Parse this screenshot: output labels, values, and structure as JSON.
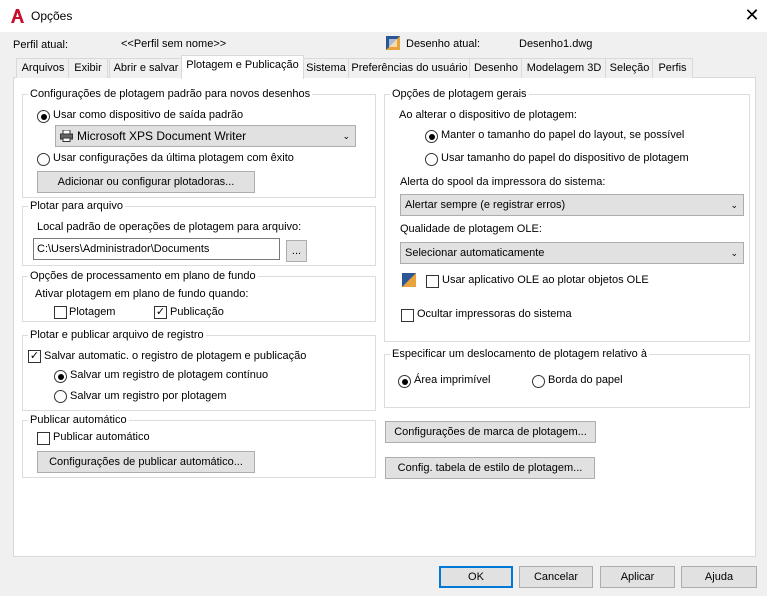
{
  "window": {
    "title": "Opções",
    "close_glyph": "✕"
  },
  "profile": {
    "label": "Perfil atual:",
    "value": "<<Perfil sem nome>>"
  },
  "drawing": {
    "label": "Desenho atual:",
    "value": "Desenho1.dwg"
  },
  "tabs": [
    {
      "label": "Arquivos"
    },
    {
      "label": "Exibir"
    },
    {
      "label": "Abrir e salvar"
    },
    {
      "label": "Plotagem e Publicação"
    },
    {
      "label": "Sistema"
    },
    {
      "label": "Preferências do usuário"
    },
    {
      "label": "Desenho"
    },
    {
      "label": "Modelagem 3D"
    },
    {
      "label": "Seleção"
    },
    {
      "label": "Perfis"
    }
  ],
  "default_plot": {
    "legend": "Configurações de plotagem padrão para novos desenhos",
    "use_default_label": "Usar como dispositivo de saída padrão",
    "device_value": "Microsoft XPS Document Writer",
    "use_last_label": "Usar configurações da última plotagem com êxito",
    "add_plotter_button": "Adicionar ou configurar plotadoras..."
  },
  "plot_to_file": {
    "legend": "Plotar para arquivo",
    "location_label": "Local padrão de operações de plotagem para arquivo:",
    "path_value": "C:\\Users\\Administrador\\Documents",
    "browse_button": "..."
  },
  "background": {
    "legend": "Opções de processamento em plano de fundo",
    "enable_label": "Ativar plotagem em plano de fundo quando:",
    "plotting_label": "Plotagem",
    "publishing_label": "Publicação",
    "publishing_check": "✓"
  },
  "log": {
    "legend": "Plotar e publicar arquivo de registro",
    "auto_save_label": "Salvar automatic. o registro de plotagem e publicação",
    "auto_save_check": "✓",
    "continuous_label": "Salvar um registro de plotagem contínuo",
    "per_plot_label": "Salvar um registro por plotagem"
  },
  "auto_publish": {
    "legend": "Publicar automático",
    "checkbox_label": "Publicar automático",
    "settings_button": "Configurações de publicar automático..."
  },
  "general": {
    "legend": "Opções de plotagem gerais",
    "on_change_label": "Ao alterar o dispositivo de plotagem:",
    "keep_size_label": "Manter o tamanho do papel do layout, se possível",
    "use_device_size_label": "Usar tamanho do papel do dispositivo de plotagem",
    "spool_label": "Alerta do spool da impressora do sistema:",
    "spool_value": "Alertar sempre (e registrar erros)",
    "ole_quality_label": "Qualidade de plotagem OLE:",
    "ole_quality_value": "Selecionar automaticamente",
    "use_ole_app_label": "Usar aplicativo OLE ao plotar objetos OLE",
    "hide_printers_label": "Ocultar impressoras do sistema"
  },
  "offset": {
    "legend": "Especificar um deslocamento de plotagem relativo à",
    "printable_label": "Área imprimível",
    "paper_edge_label": "Borda do papel"
  },
  "stamp_button": "Configurações de marca de plotagem...",
  "style_table_button": "Config. tabela de estilo de plotagem...",
  "footer": {
    "ok": "OK",
    "cancel": "Cancelar",
    "apply": "Aplicar",
    "help": "Ajuda"
  },
  "colors": {
    "accent": "#0078d7",
    "brand_red": "#c8102e"
  }
}
